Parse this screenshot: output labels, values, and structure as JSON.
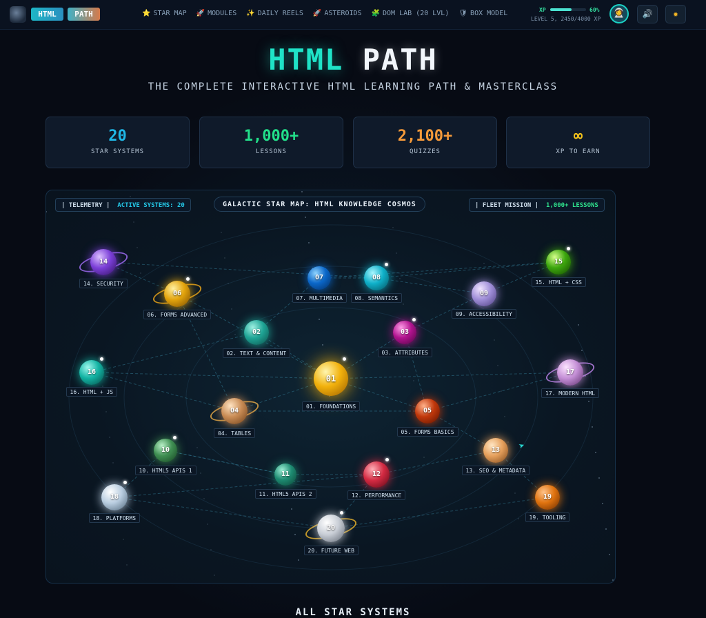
{
  "nav": {
    "logo_html": "HTML",
    "logo_path": "PATH",
    "items": [
      {
        "icon": "star-icon",
        "glyph": "⭐",
        "label": "STAR MAP"
      },
      {
        "icon": "rocket-icon",
        "glyph": "🚀",
        "label": "MODULES"
      },
      {
        "icon": "reel-icon",
        "glyph": "✨",
        "label": "DAILY REELS"
      },
      {
        "icon": "asteroid-icon",
        "glyph": "🚀",
        "label": "ASTEROIDS"
      },
      {
        "icon": "puzzle-icon",
        "glyph": "🧩",
        "label": "DOM LAB (20 LVL)"
      },
      {
        "icon": "shield-icon",
        "glyph": "🛡",
        "label": "BOX MODEL"
      }
    ],
    "xp_label": "XP",
    "xp_progress": 0.6,
    "xp_percent": "60%",
    "level_text": "LEVEL 5, 2450/4000 XP"
  },
  "hero": {
    "title_part1": "HTML",
    "title_part2": "PATH",
    "subtitle": "THE COMPLETE INTERACTIVE HTML LEARNING PATH & MASTERCLASS"
  },
  "stats": [
    {
      "value": "20",
      "label": "STAR SYSTEMS",
      "color": "#1fb8e8"
    },
    {
      "value": "1,000+",
      "label": "LESSONS",
      "color": "#22e08a"
    },
    {
      "value": "2,100+",
      "label": "QUIZZES",
      "color": "#f59a3a"
    },
    {
      "value": "∞",
      "label": "XP TO EARN",
      "color": "#f3c21b"
    }
  ],
  "map": {
    "telemetry_label": "| TELEMETRY |",
    "telemetry_value": "ACTIVE SYSTEMS: 20",
    "title": "GALACTIC STAR MAP: HTML KNOWLEDGE COSMOS",
    "fleet_label": "| FLEET MISSION |",
    "fleet_value": "1,000+ LESSONS",
    "planets": [
      {
        "num": "01",
        "label": "01. FOUNDATIONS"
      },
      {
        "num": "02",
        "label": "02. TEXT & CONTENT"
      },
      {
        "num": "03",
        "label": "03. ATTRIBUTES"
      },
      {
        "num": "04",
        "label": "04. TABLES"
      },
      {
        "num": "05",
        "label": "05. FORMS BASICS"
      },
      {
        "num": "06",
        "label": "06. FORMS ADVANCED"
      },
      {
        "num": "07",
        "label": "07. MULTIMEDIA"
      },
      {
        "num": "08",
        "label": "08. SEMANTICS"
      },
      {
        "num": "09",
        "label": "09. ACCESSIBILITY"
      },
      {
        "num": "10",
        "label": "10. HTML5 APIS 1"
      },
      {
        "num": "11",
        "label": "11. HTML5 APIS 2"
      },
      {
        "num": "12",
        "label": "12. PERFORMANCE"
      },
      {
        "num": "13",
        "label": "13. SEO & METADATA"
      },
      {
        "num": "14",
        "label": "14. SECURITY"
      },
      {
        "num": "15",
        "label": "15. HTML + CSS"
      },
      {
        "num": "16",
        "label": "16. HTML + JS"
      },
      {
        "num": "17",
        "label": "17. MODERN HTML"
      },
      {
        "num": "18",
        "label": "18. PLATFORMS"
      },
      {
        "num": "19",
        "label": "19. TOOLING"
      },
      {
        "num": "20",
        "label": "20. FUTURE WEB"
      }
    ]
  },
  "bottom_heading": "ALL STAR SYSTEMS"
}
